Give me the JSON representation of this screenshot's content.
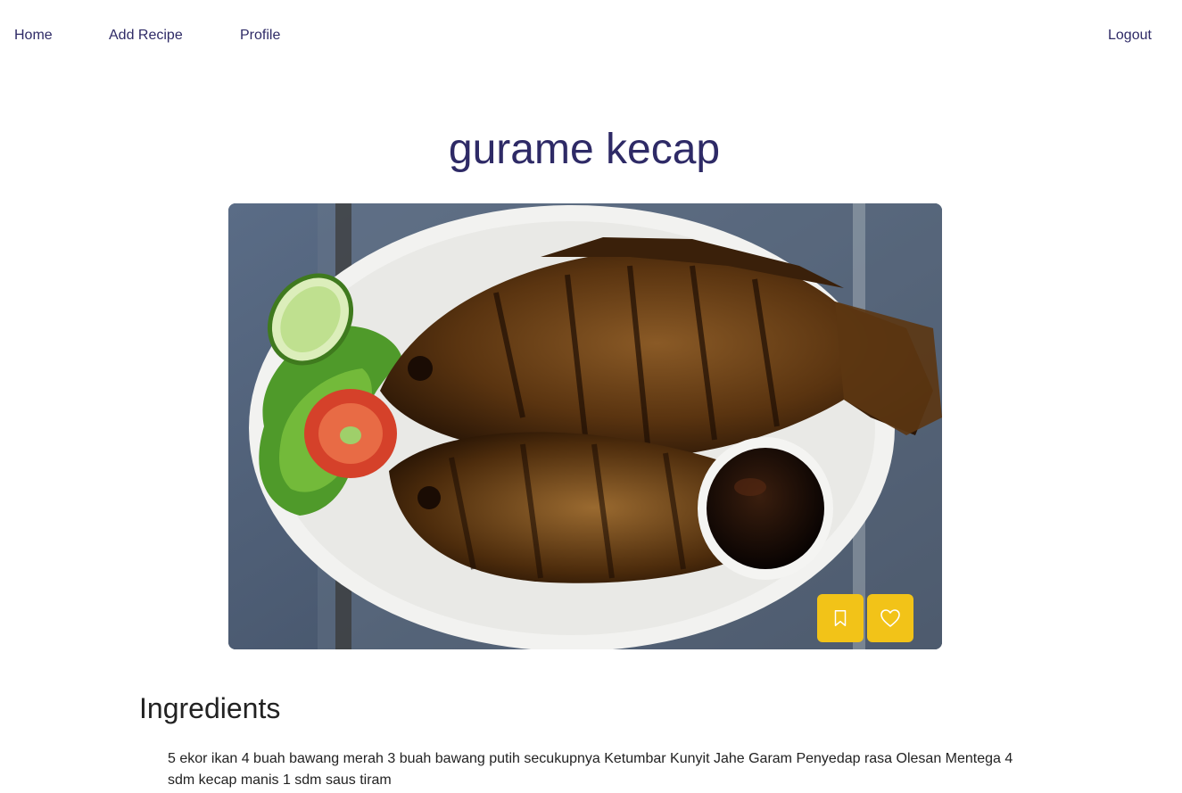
{
  "nav": {
    "home": "Home",
    "add_recipe": "Add Recipe",
    "profile": "Profile",
    "logout": "Logout"
  },
  "recipe": {
    "title": "gurame kecap",
    "image_alt": "gurame kecap",
    "ingredients_heading": "Ingredients",
    "ingredients_text": "5 ekor ikan 4 buah bawang merah 3 buah bawang putih secukupnya Ketumbar Kunyit Jahe Garam Penyedap rasa Olesan Mentega 4 sdm kecap manis 1 sdm saus tiram"
  },
  "actions": {
    "bookmark_icon": "bookmark-icon",
    "like_icon": "heart-icon"
  },
  "colors": {
    "brand_text": "#2e2a66",
    "action_button": "#f2c318"
  }
}
